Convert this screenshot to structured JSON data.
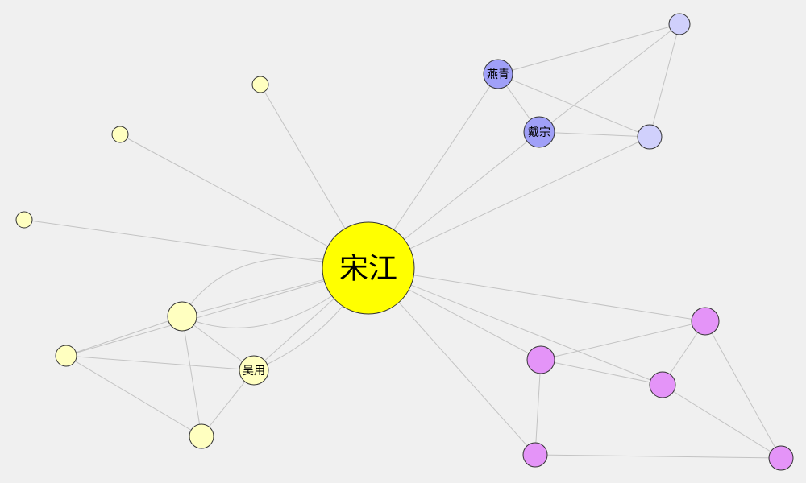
{
  "colors": {
    "background": "#f0f0f0",
    "edge": "#c3c3c3",
    "group_main": "#ffff00",
    "group_yellow": "#ffffc0",
    "group_blue_dark": "#a0a0f8",
    "group_blue_light": "#d0d0fc",
    "group_magenta": "#e494f8"
  },
  "nodes": [
    {
      "id": "songjiang",
      "label": "宋江",
      "group": "main"
    },
    {
      "id": "wuyong",
      "label": "吴用",
      "group": "yellow"
    },
    {
      "id": "yanqing",
      "label": "燕青",
      "group": "blue_dark"
    },
    {
      "id": "daizong",
      "label": "戴宗",
      "group": "blue_dark"
    },
    {
      "id": "b1",
      "label": "",
      "group": "blue_light"
    },
    {
      "id": "b2",
      "label": "",
      "group": "blue_light"
    },
    {
      "id": "y1",
      "label": "",
      "group": "yellow"
    },
    {
      "id": "y2",
      "label": "",
      "group": "yellow"
    },
    {
      "id": "y3",
      "label": "",
      "group": "yellow"
    },
    {
      "id": "y4",
      "label": "",
      "group": "yellow"
    },
    {
      "id": "y5",
      "label": "",
      "group": "yellow"
    },
    {
      "id": "y6",
      "label": "",
      "group": "yellow"
    },
    {
      "id": "p1",
      "label": "",
      "group": "magenta"
    },
    {
      "id": "p2",
      "label": "",
      "group": "magenta"
    },
    {
      "id": "p3",
      "label": "",
      "group": "magenta"
    },
    {
      "id": "p4",
      "label": "",
      "group": "magenta"
    },
    {
      "id": "p5",
      "label": "",
      "group": "magenta"
    }
  ],
  "edges": [
    [
      "songjiang",
      "y1"
    ],
    [
      "songjiang",
      "y2"
    ],
    [
      "songjiang",
      "y3"
    ],
    [
      "songjiang",
      "y4"
    ],
    [
      "songjiang",
      "y5"
    ],
    [
      "songjiang",
      "wuyong"
    ],
    [
      "songjiang",
      "yanqing"
    ],
    [
      "songjiang",
      "daizong"
    ],
    [
      "songjiang",
      "b2"
    ],
    [
      "songjiang",
      "p1"
    ],
    [
      "songjiang",
      "p2"
    ],
    [
      "songjiang",
      "p3"
    ],
    [
      "songjiang",
      "p4"
    ],
    [
      "yanqing",
      "daizong"
    ],
    [
      "yanqing",
      "b1"
    ],
    [
      "yanqing",
      "b2"
    ],
    [
      "daizong",
      "b1"
    ],
    [
      "daizong",
      "b2"
    ],
    [
      "b1",
      "b2"
    ],
    [
      "y4",
      "y5"
    ],
    [
      "y4",
      "wuyong"
    ],
    [
      "y5",
      "wuyong"
    ],
    [
      "y5",
      "y6"
    ],
    [
      "y4",
      "y6"
    ],
    [
      "wuyong",
      "y6"
    ],
    [
      "p1",
      "p2"
    ],
    [
      "p1",
      "p3"
    ],
    [
      "p1",
      "p4"
    ],
    [
      "p2",
      "p3"
    ],
    [
      "p2",
      "p5"
    ],
    [
      "p3",
      "p5"
    ],
    [
      "p4",
      "p5"
    ]
  ],
  "curved_edges": [
    [
      "songjiang",
      "y4"
    ],
    [
      "songjiang",
      "wuyong"
    ],
    [
      "songjiang",
      "y4"
    ]
  ]
}
